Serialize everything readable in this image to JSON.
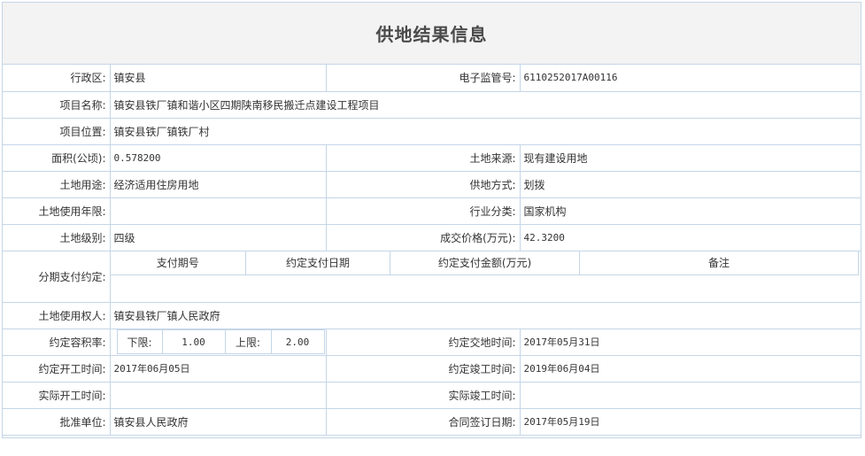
{
  "title": "供地结果信息",
  "rows": {
    "district": {
      "label": "行政区:",
      "value": "镇安县"
    },
    "supervision_no": {
      "label": "电子监管号:",
      "value": "6110252017A00116"
    },
    "project_name": {
      "label": "项目名称:",
      "value": "镇安县铁厂镇和谐小区四期陕南移民搬迁点建设工程项目"
    },
    "project_location": {
      "label": "项目位置:",
      "value": "镇安县铁厂镇铁厂村"
    },
    "area": {
      "label": "面积(公顷):",
      "value": "0.578200"
    },
    "land_source": {
      "label": "土地来源:",
      "value": "现有建设用地"
    },
    "land_use": {
      "label": "土地用途:",
      "value": "经济适用住房用地"
    },
    "supply_method": {
      "label": "供地方式:",
      "value": "划拨"
    },
    "use_term": {
      "label": "土地使用年限:",
      "value": ""
    },
    "industry": {
      "label": "行业分类:",
      "value": "国家机构"
    },
    "land_grade": {
      "label": "土地级别:",
      "value": "四级"
    },
    "price": {
      "label": "成交价格(万元):",
      "value": "42.3200"
    },
    "installment": {
      "label": "分期支付约定:",
      "columns": [
        "支付期号",
        "约定支付日期",
        "约定支付金额(万元)",
        "备注"
      ]
    },
    "land_user": {
      "label": "土地使用权人:",
      "value": "镇安县铁厂镇人民政府"
    },
    "far": {
      "label": "约定容积率:",
      "lower_label": "下限:",
      "lower_value": "1.00",
      "upper_label": "上限:",
      "upper_value": "2.00"
    },
    "delivery_time": {
      "label": "约定交地时间:",
      "value": "2017年05月31日"
    },
    "start_time": {
      "label": "约定开工时间:",
      "value": "2017年06月05日"
    },
    "completion_time": {
      "label": "约定竣工时间:",
      "value": "2019年06月04日"
    },
    "actual_start": {
      "label": "实际开工时间:",
      "value": ""
    },
    "actual_completion": {
      "label": "实际竣工时间:",
      "value": ""
    },
    "approver": {
      "label": "批准单位:",
      "value": "镇安县人民政府"
    },
    "contract_date": {
      "label": "合同签订日期:",
      "value": "2017年05月19日"
    }
  }
}
